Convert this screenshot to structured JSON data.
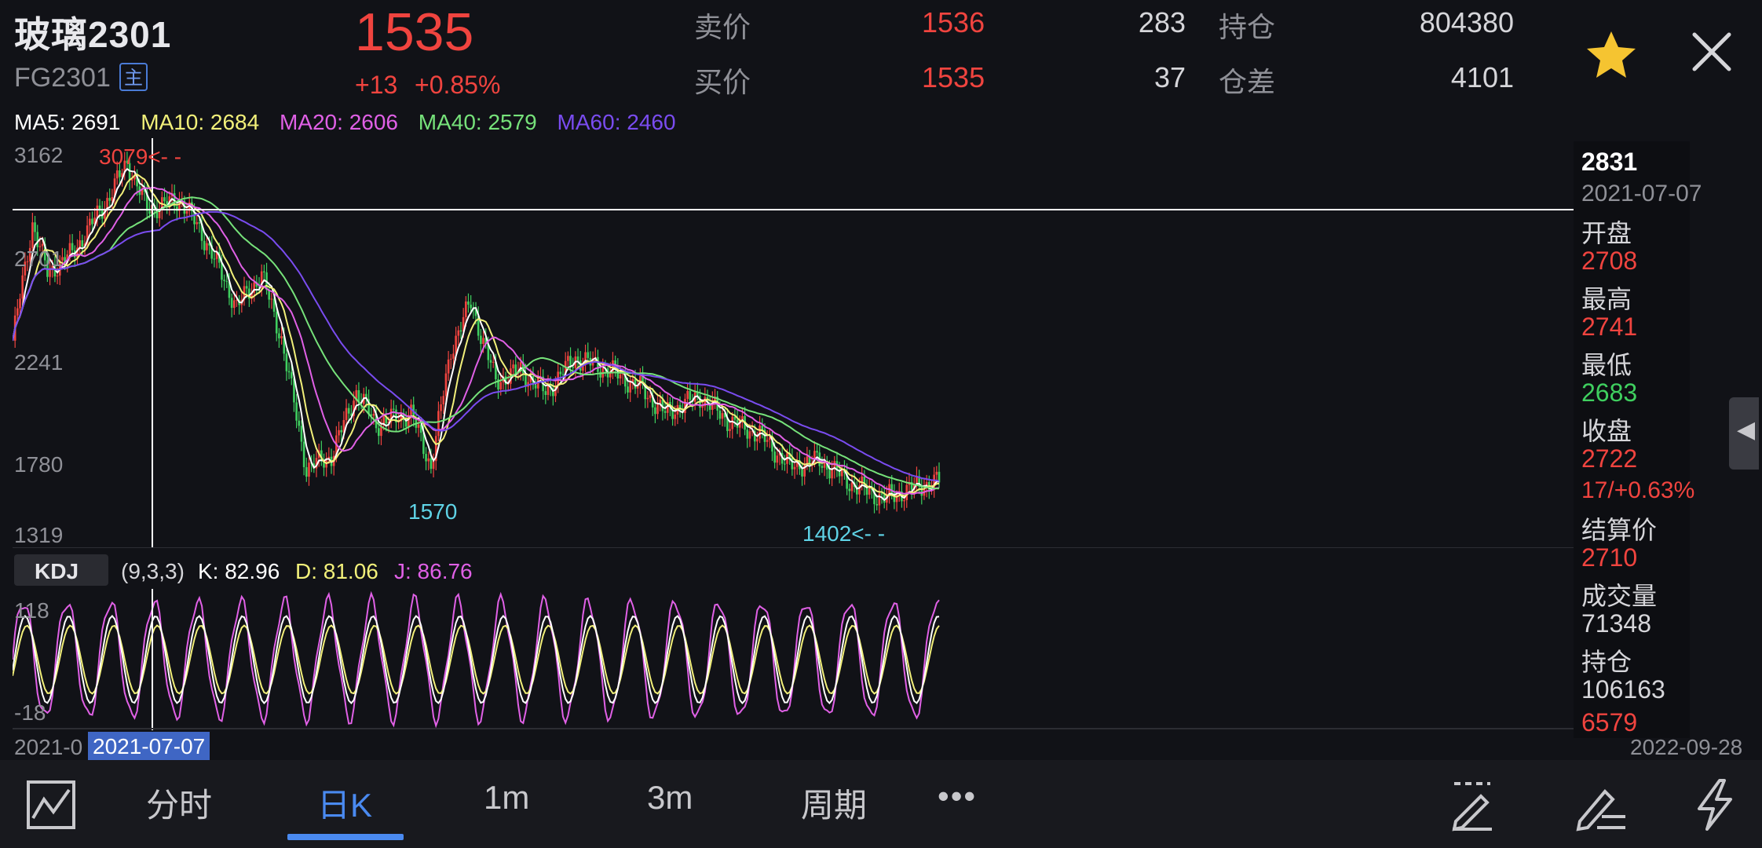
{
  "header": {
    "title": "玻璃2301",
    "code": "FG2301",
    "main_badge": "主",
    "last_price": "1535",
    "change": "+13",
    "change_pct": "+0.85%",
    "ask_label": "卖价",
    "ask_price": "1536",
    "ask_volume": "283",
    "bid_label": "买价",
    "bid_price": "1535",
    "bid_volume": "37",
    "open_interest_label": "持仓",
    "open_interest": "804380",
    "oi_change_label": "仓差",
    "oi_change": "4101"
  },
  "ma_legend": {
    "ma5": "MA5: 2691",
    "ma10": "MA10: 2684",
    "ma20": "MA20: 2606",
    "ma40": "MA40: 2579",
    "ma60": "MA60: 2460"
  },
  "colors": {
    "up": "#f0443f",
    "down": "#3fcf5f",
    "ma5": "#ffffff",
    "ma10": "#f2f07a",
    "ma20": "#e060e6",
    "ma40": "#76e27a",
    "ma60": "#7a4cf0",
    "accent": "#4a8af0"
  },
  "main_chart": {
    "y_labels": [
      "3162",
      "2701",
      "2241",
      "1780",
      "1319"
    ],
    "high_marker": "3079<- -",
    "low_marker_1": "1570",
    "low_marker_2": "1402<- -",
    "y_range": [
      1319,
      3162
    ],
    "cursor_price": 2831
  },
  "kdj": {
    "label": "KDJ",
    "params": "(9,3,3)",
    "k": "K: 82.96",
    "d": "D: 81.06",
    "j": "J: 86.76",
    "y_top": "118",
    "y_bottom": "-18"
  },
  "dates": {
    "left": "2021-0",
    "cursor": "2021-07-07",
    "right": "2022-09-28"
  },
  "info_panel": {
    "price": "2831",
    "date": "2021-07-07",
    "open_label": "开盘",
    "open": "2708",
    "high_label": "最高",
    "high": "2741",
    "low_label": "最低",
    "low": "2683",
    "close_label": "收盘",
    "close": "2722",
    "change": "17/+0.63%",
    "settle_label": "结算价",
    "settle": "2710",
    "volume_label": "成交量",
    "volume": "71348",
    "oi_label": "持仓",
    "oi": "106163",
    "oi_change": "6579"
  },
  "toolbar": {
    "tab_intraday": "分时",
    "tab_day_k": "日K",
    "tab_1m": "1m",
    "tab_3m": "3m",
    "tab_period": "周期",
    "more": "•••"
  },
  "icons": [
    "line-chart-icon",
    "star-icon",
    "close-icon",
    "draw-line-icon",
    "edit-pen-icon",
    "lightning-icon",
    "side-arrow-icon"
  ]
}
